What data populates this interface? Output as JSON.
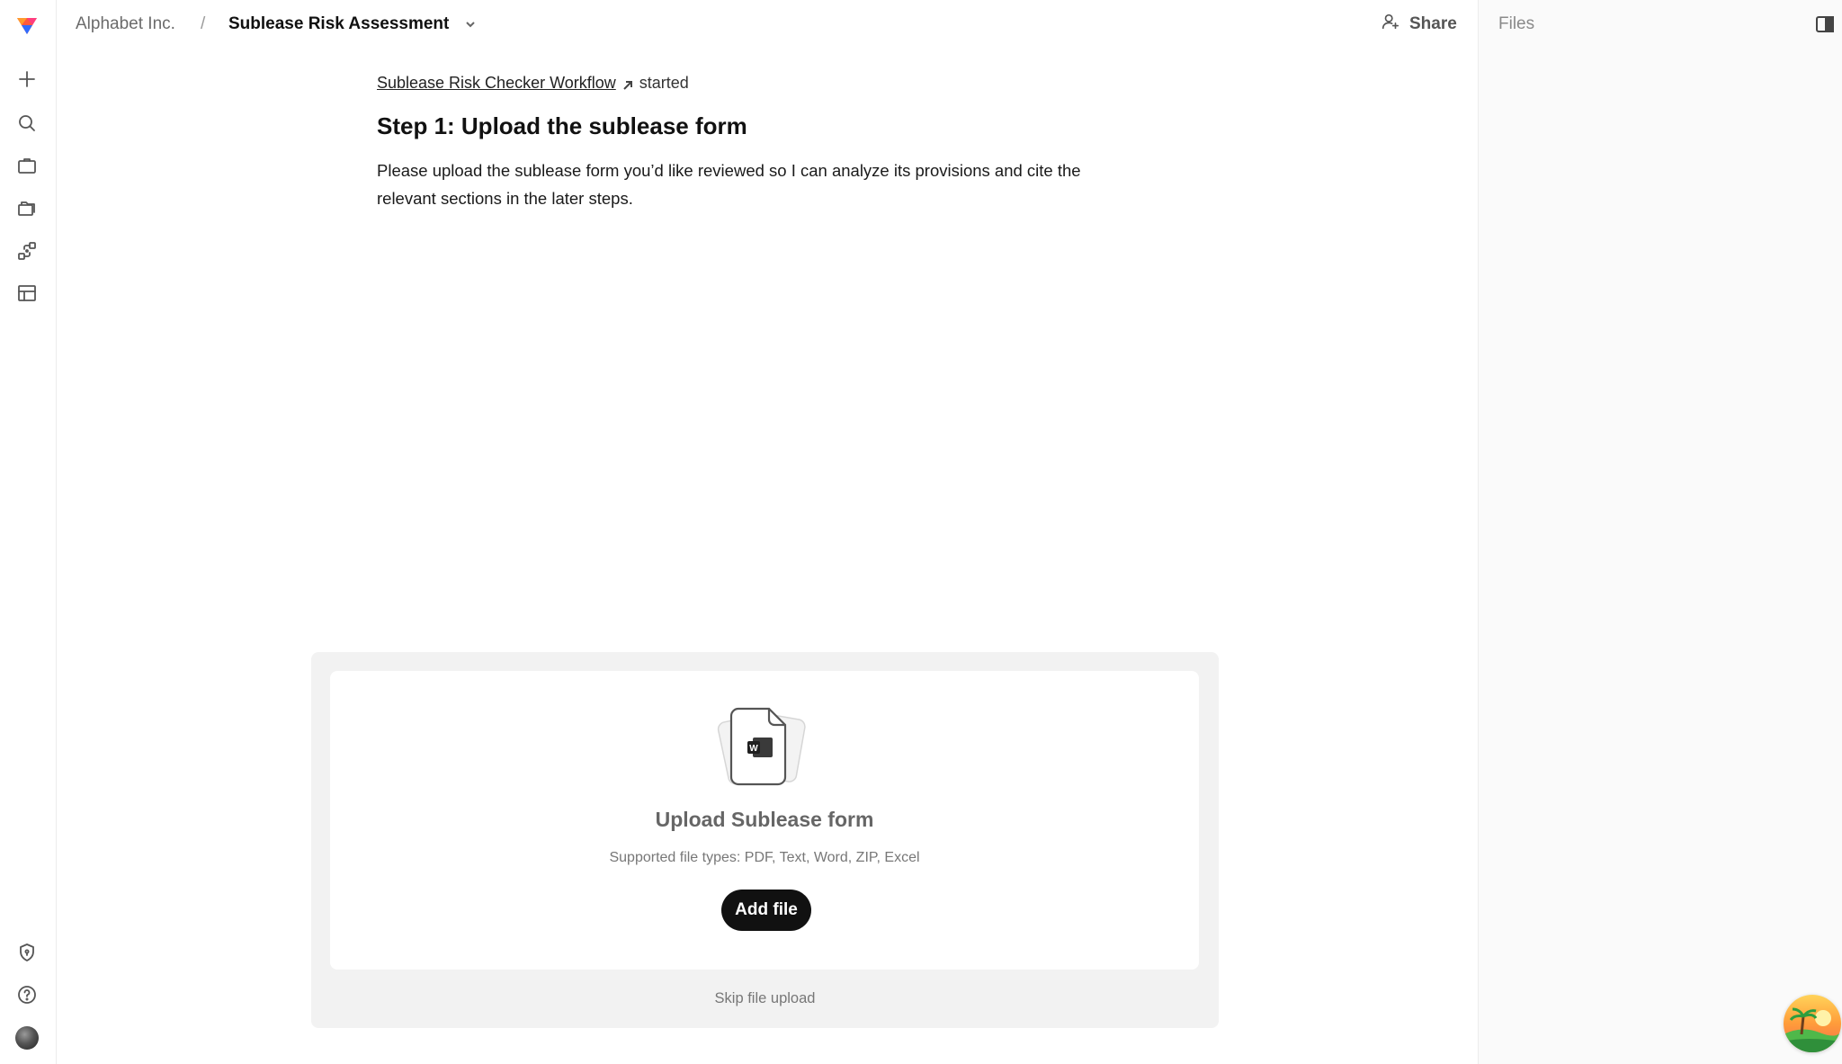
{
  "header": {
    "org": "Alphabet Inc.",
    "separator": "/",
    "title": "Sublease Risk Assessment",
    "share_label": "Share"
  },
  "files_panel": {
    "title": "Files"
  },
  "workflow": {
    "link_text": "Sublease Risk Checker Workflow",
    "status": "started"
  },
  "step": {
    "title": "Step 1: Upload the sublease form",
    "description": "Please upload the sublease form you’d like reviewed so I can analyze its provisions and cite the relevant sections in the later steps."
  },
  "upload": {
    "title": "Upload Sublease form",
    "supported": "Supported file types: PDF, Text, Word, ZIP, Excel",
    "add_label": "Add file",
    "skip_label": "Skip file upload",
    "file_badge": "W"
  },
  "colors": {
    "accent_button": "#111111",
    "upload_background": "#f2f2f2",
    "panel_background": "#fafafa"
  },
  "icons": [
    "logo-icon",
    "new-icon",
    "search-icon",
    "briefcase-icon",
    "folders-icon",
    "workflow-icon",
    "table-icon",
    "shield-icon",
    "help-icon",
    "chevron-down-icon",
    "share-user-icon",
    "panel-toggle-icon",
    "external-arrow-icon",
    "word-file-icon"
  ]
}
